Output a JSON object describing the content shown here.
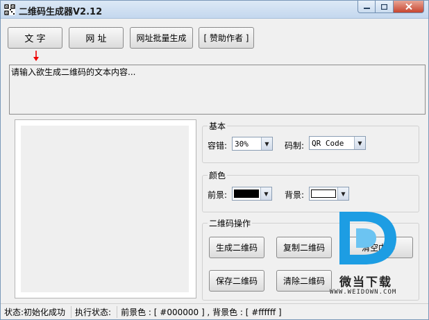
{
  "window": {
    "title": "二维码生成器V2.12"
  },
  "toolbar": {
    "text_button": "文  字",
    "url_button": "网  址",
    "batch_button": "网址批量生成",
    "donate_button": "[ 赞助作者 ]"
  },
  "input": {
    "placeholder": "请输入欲生成二维码的文本内容..."
  },
  "basic": {
    "title": "基本",
    "error_label": "容错:",
    "error_value": "30%",
    "code_label": "码制:",
    "code_value": "QR Code"
  },
  "color": {
    "title": "颜色",
    "fg_label": "前景:",
    "fg_value": "#000000",
    "bg_label": "背景:",
    "bg_value": "#ffffff"
  },
  "ops": {
    "title": "二维码操作",
    "generate": "生成二维码",
    "copy": "复制二维码",
    "clear_content": "清空内容",
    "save": "保存二维码",
    "clear_qr": "清除二维码"
  },
  "status": {
    "state": "状态:初始化成功",
    "exec": "执行状态:",
    "colors": "前景色 : [ #000000 ] , 背景色 : [ #ffffff ]"
  },
  "watermark": {
    "name": "微当下载",
    "url": "WWW.WEIDOWN.COM"
  }
}
